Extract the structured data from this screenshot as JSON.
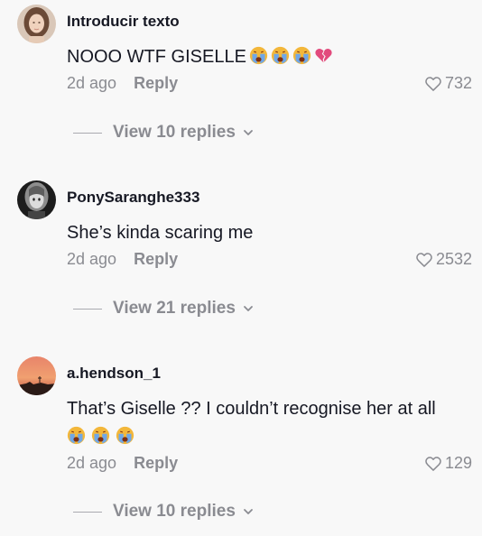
{
  "comments": [
    {
      "username": "Introducir texto",
      "text": "NOOO WTF GISELLE",
      "emojis": [
        "crying-face-icon",
        "crying-face-icon",
        "crying-face-icon",
        "broken-heart-icon"
      ],
      "time": "2d ago",
      "reply_label": "Reply",
      "likes": "732",
      "view_replies": "View 10 replies"
    },
    {
      "username": "PonySaranghe333",
      "text": "She’s kinda scaring me",
      "emojis": [],
      "time": "2d ago",
      "reply_label": "Reply",
      "likes": "2532",
      "view_replies": "View 21 replies"
    },
    {
      "username": "a.hendson_1",
      "text": "That’s Giselle ?? I couldn’t recognise her at all",
      "emojis": [
        "crying-face-icon",
        "crying-face-icon",
        "crying-face-icon"
      ],
      "time": "2d ago",
      "reply_label": "Reply",
      "likes": "129",
      "view_replies": "View 10 replies"
    }
  ],
  "colors": {
    "background": "#f8f8f8",
    "text": "#161823",
    "muted": "#8a8b91"
  }
}
